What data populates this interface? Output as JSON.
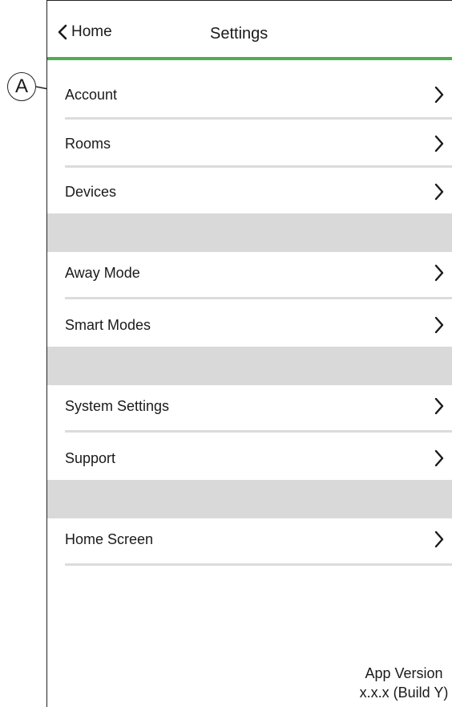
{
  "header": {
    "back_label": "Home",
    "title": "Settings",
    "accent_color": "#4caf50"
  },
  "callout": {
    "letter": "A"
  },
  "sections": [
    {
      "items": [
        {
          "label": "Account",
          "icon": "chevron-right-icon"
        },
        {
          "label": "Rooms",
          "icon": "chevron-right-icon"
        },
        {
          "label": "Devices",
          "icon": "chevron-right-icon"
        }
      ]
    },
    {
      "items": [
        {
          "label": "Away Mode",
          "icon": "chevron-right-icon"
        },
        {
          "label": "Smart Modes",
          "icon": "chevron-right-icon"
        }
      ]
    },
    {
      "items": [
        {
          "label": "System Settings",
          "icon": "chevron-right-icon"
        },
        {
          "label": "Support",
          "icon": "chevron-right-icon"
        }
      ]
    },
    {
      "items": [
        {
          "label": "Home Screen",
          "icon": "chevron-right-icon"
        }
      ]
    }
  ],
  "footer": {
    "version_label": "App Version",
    "version_value": "x.x.x (Build Y)"
  }
}
